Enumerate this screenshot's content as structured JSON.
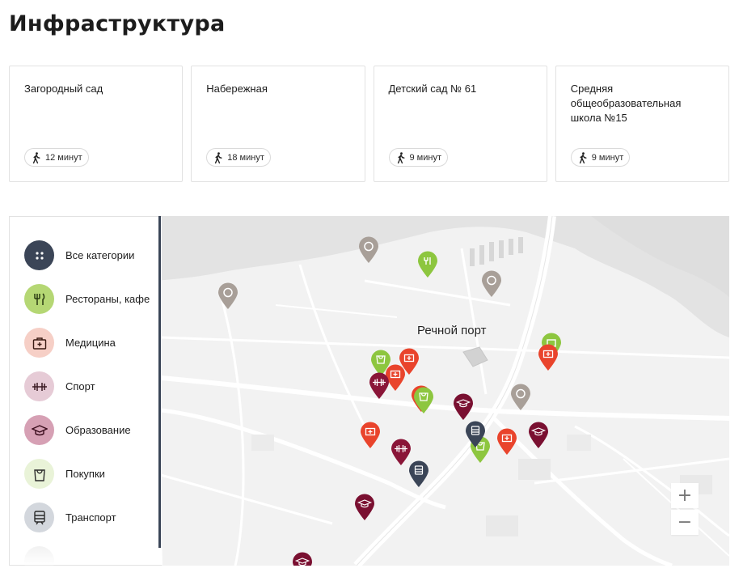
{
  "page": {
    "title": "Инфраструктура"
  },
  "cards": [
    {
      "title": "Загородный сад",
      "time": "12 минут"
    },
    {
      "title": "Набережная",
      "time": "18 минут"
    },
    {
      "title": "Детский сад № 61",
      "time": "9 минут"
    },
    {
      "title": "Средняя общеобразовательная школа №15",
      "time": "9 минут"
    }
  ],
  "legend": {
    "items": [
      {
        "label": "Все категории",
        "icon": "dots-icon",
        "bg": "#3b4557",
        "fg": "#ffffff"
      },
      {
        "label": "Рестораны, кафе",
        "icon": "fork-knife-icon",
        "bg": "#b5d774",
        "fg": "#2a3a12"
      },
      {
        "label": "Медицина",
        "icon": "medical-kit-icon",
        "bg": "#f6cfc6",
        "fg": "#e64a2e"
      },
      {
        "label": "Спорт",
        "icon": "dumbbell-icon",
        "bg": "#e6cbd6",
        "fg": "#8a1538"
      },
      {
        "label": "Образование",
        "icon": "graduation-cap-icon",
        "bg": "#d6a0b4",
        "fg": "#7a1031"
      },
      {
        "label": "Покупки",
        "icon": "shopping-bag-icon",
        "bg": "#e9f3d8",
        "fg": "#3c4a20"
      },
      {
        "label": "Транспорт",
        "icon": "train-icon",
        "bg": "#d3d7dd",
        "fg": "#3b4557"
      }
    ]
  },
  "map": {
    "label": "Речной порт",
    "zoom_in": "+",
    "zoom_out": "−"
  },
  "colors": {
    "restaurant": "#8dc63f",
    "medicine": "#e9442c",
    "sport": "#8a1538",
    "education": "#7a1031",
    "shopping": "#8dc63f",
    "transport": "#3b4557",
    "landmark": "#a89f98"
  }
}
